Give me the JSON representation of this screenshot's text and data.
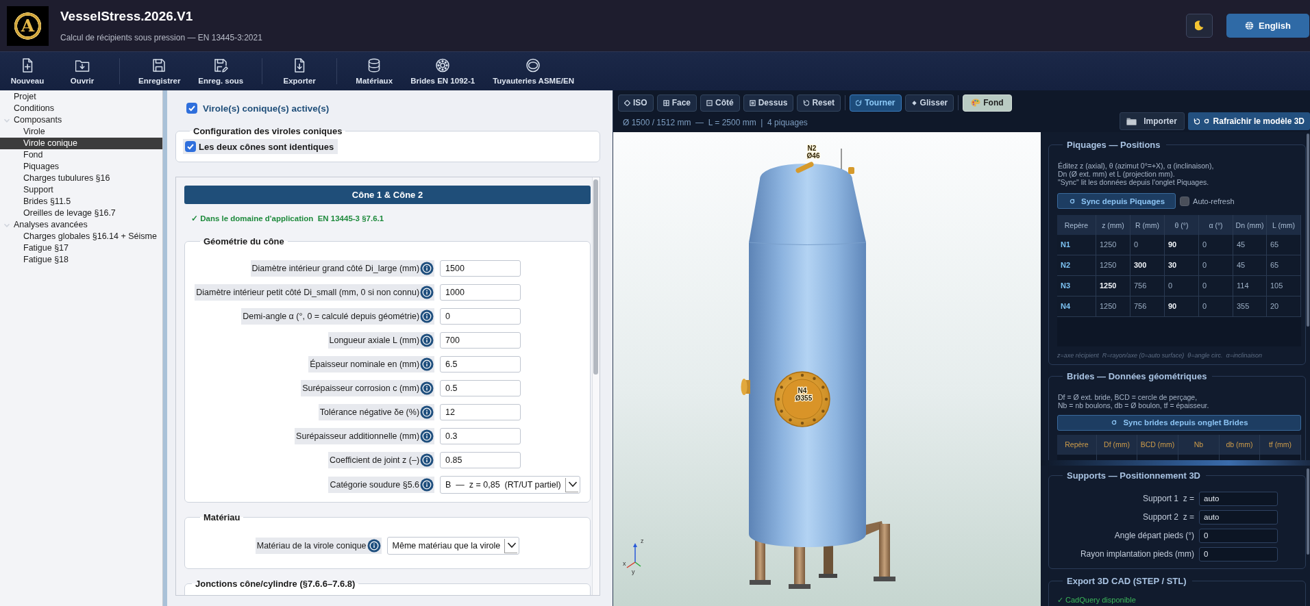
{
  "header": {
    "logo_letter": "A",
    "title": "VesselStress.2026.V1",
    "subtitle": "Calcul de récipients sous pression — EN 13445-3:2021",
    "language_button": "English"
  },
  "toolbar": {
    "groups": [
      [
        "Nouveau",
        "Ouvrir"
      ],
      [
        "Enregistrer",
        "Enreg. sous"
      ],
      [
        "Exporter"
      ],
      [
        "Matériaux",
        "Brides EN 1092-1",
        "Tuyauteries ASME/EN"
      ]
    ]
  },
  "sidebar": {
    "items": [
      {
        "label": "Projet",
        "selected": false
      },
      {
        "label": "Conditions",
        "selected": false
      },
      {
        "label": "Composants",
        "selected": false,
        "expanded": true,
        "children": [
          {
            "label": "Virole",
            "selected": false
          },
          {
            "label": "Virole conique",
            "selected": true
          },
          {
            "label": "Fond",
            "selected": false
          },
          {
            "label": "Piquages",
            "selected": false
          },
          {
            "label": "Charges tubulures §16",
            "selected": false
          },
          {
            "label": "Support",
            "selected": false
          },
          {
            "label": "Brides §11.5",
            "selected": false
          },
          {
            "label": "Oreilles de levage §16.7",
            "selected": false
          }
        ]
      },
      {
        "label": "Analyses avancées",
        "selected": false,
        "expanded": true,
        "children": [
          {
            "label": "Charges globales §16.14 + Séisme",
            "selected": false
          },
          {
            "label": "Fatigue §17",
            "selected": false
          },
          {
            "label": "Fatigue §18",
            "selected": false
          }
        ]
      }
    ]
  },
  "form": {
    "active_toggle": {
      "label": "Virole(s) conique(s) active(s)",
      "checked": true
    },
    "config_group": {
      "legend": "Configuration des viroles coniques",
      "identical": {
        "label": "Les deux cônes sont identiques",
        "checked": true
      }
    },
    "cone_header": "Cône 1 & Cône 2",
    "validity": "✓ Dans le domaine d'application  EN 13445-3 §7.6.1",
    "geometry": {
      "legend": "Géométrie du cône",
      "fields": [
        {
          "label": "Diamètre intérieur grand côté Di_large (mm)",
          "value": "1500",
          "kind": "input"
        },
        {
          "label": "Diamètre intérieur petit côté Di_small (mm, 0 si non connu)",
          "value": "1000",
          "kind": "input"
        },
        {
          "label": "Demi-angle α (°, 0 = calculé depuis géométrie)",
          "value": "0",
          "kind": "input"
        },
        {
          "label": "Longueur axiale L (mm)",
          "value": "700",
          "kind": "input"
        },
        {
          "label": "Épaisseur nominale en (mm)",
          "value": "6.5",
          "kind": "input"
        },
        {
          "label": "Surépaisseur corrosion c (mm)",
          "value": "0.5",
          "kind": "input"
        },
        {
          "label": "Tolérance négative δe (%)",
          "value": "12",
          "kind": "input"
        },
        {
          "label": "Surépaisseur additionnelle (mm)",
          "value": "0.3",
          "kind": "input"
        },
        {
          "label": "Coefficient de joint z (–)",
          "value": "0.85",
          "kind": "input"
        },
        {
          "label": "Catégorie soudure §5.6",
          "value": "B  —  z = 0,85  (RT/UT partiel)",
          "kind": "select"
        }
      ]
    },
    "material": {
      "legend": "Matériau",
      "fields": [
        {
          "label": "Matériau de la virole conique",
          "value": "Même matériau que la virole",
          "kind": "select"
        }
      ]
    },
    "junctions": {
      "legend": "Jonctions cône/cylindre (§7.6.6–7.6.8)"
    }
  },
  "viewer": {
    "views": [
      "ISO",
      "Face",
      "Côté",
      "Dessus",
      "Reset"
    ],
    "modes": [
      {
        "label": "Tourner",
        "selected": true
      },
      {
        "label": "Glisser",
        "selected": false
      }
    ],
    "background_button": "Fond",
    "info": "Ø 1500 / 1512 mm  —  L = 2500 mm  |  4 piquages",
    "import_button": "Importer",
    "refresh_button": "Rafraîchir le modèle 3D",
    "scene_labels": [
      {
        "tag": "N2",
        "size": "Ø46"
      },
      {
        "tag": "N4",
        "size": "Ø355"
      }
    ],
    "axis_labels": [
      "z",
      "x",
      "y"
    ]
  },
  "side_panel": {
    "nozzles": {
      "legend": "Piquages — Positions",
      "help": "Éditez z (axial), θ (azimut 0°=+X), α (inclinaison),\nDn (Ø ext. mm) et L (projection mm).\n\"Sync\" lit les données depuis l'onglet Piquages.",
      "sync_button": "Sync depuis Piquages",
      "auto_refresh": {
        "label": "Auto-refresh",
        "checked": false
      },
      "columns": [
        "Repère",
        "z (mm)",
        "R (mm)",
        "θ (°)",
        "α (°)",
        "Dn (mm)",
        "L (mm)"
      ],
      "rows": [
        {
          "cells": [
            {
              "text": "N1",
              "highlighted": false
            },
            {
              "text": "1250",
              "highlighted": false
            },
            {
              "text": "0",
              "highlighted": false
            },
            {
              "text": "90",
              "highlighted": true
            },
            {
              "text": "0",
              "highlighted": false
            },
            {
              "text": "45",
              "highlighted": false
            },
            {
              "text": "65",
              "highlighted": false
            }
          ]
        },
        {
          "cells": [
            {
              "text": "N2",
              "highlighted": false
            },
            {
              "text": "1250",
              "highlighted": false
            },
            {
              "text": "300",
              "highlighted": true
            },
            {
              "text": "30",
              "highlighted": true
            },
            {
              "text": "0",
              "highlighted": false
            },
            {
              "text": "45",
              "highlighted": false
            },
            {
              "text": "65",
              "highlighted": false
            }
          ]
        },
        {
          "cells": [
            {
              "text": "N3",
              "highlighted": false
            },
            {
              "text": "1250",
              "highlighted": true
            },
            {
              "text": "756",
              "highlighted": false
            },
            {
              "text": "0",
              "highlighted": false
            },
            {
              "text": "0",
              "highlighted": false
            },
            {
              "text": "114",
              "highlighted": false
            },
            {
              "text": "105",
              "highlighted": false
            }
          ]
        },
        {
          "cells": [
            {
              "text": "N4",
              "highlighted": false
            },
            {
              "text": "1250",
              "highlighted": false
            },
            {
              "text": "756",
              "highlighted": false
            },
            {
              "text": "90",
              "highlighted": true
            },
            {
              "text": "0",
              "highlighted": false
            },
            {
              "text": "355",
              "highlighted": false
            },
            {
              "text": "20",
              "highlighted": false
            }
          ]
        }
      ],
      "note": "z=axe récipient  R=rayon/axe (0=auto surface)  θ=angle circ.  α=inclinaison"
    },
    "flanges": {
      "legend": "Brides — Données géométriques",
      "help": "Df = Ø ext. bride, BCD = cercle de perçage,\nNb = nb boulons, db = Ø boulon, tf = épaisseur.",
      "sync_button": "Sync brides depuis onglet Brides",
      "columns": [
        "Repère",
        "Df (mm)",
        "BCD (mm)",
        "Nb",
        "db (mm)",
        "tf (mm)"
      ]
    },
    "supports": {
      "legend": "Supports — Positionnement 3D",
      "fields": [
        {
          "label": "Support 1  z =",
          "value": "auto"
        },
        {
          "label": "Support 2  z =",
          "value": "auto"
        },
        {
          "label": "Angle départ pieds (°)",
          "value": "0"
        },
        {
          "label": "Rayon implantation pieds (mm)",
          "value": "0"
        }
      ]
    },
    "export": {
      "legend": "Export 3D CAD (STEP / STL)",
      "status": "✓ CadQuery disponible"
    }
  }
}
